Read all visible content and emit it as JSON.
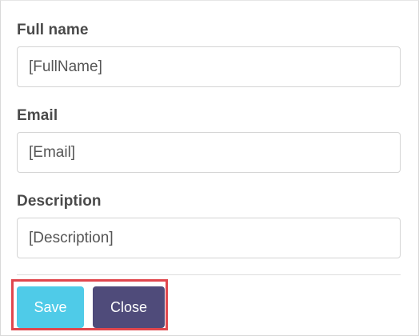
{
  "form": {
    "full_name": {
      "label": "Full name",
      "value": "[FullName]"
    },
    "email": {
      "label": "Email",
      "value": "[Email]"
    },
    "description": {
      "label": "Description",
      "value": "[Description]"
    }
  },
  "actions": {
    "save_label": "Save",
    "close_label": "Close"
  },
  "colors": {
    "save_button": "#4fcbe8",
    "close_button": "#4f4b7a",
    "highlight_border": "#e0464d"
  }
}
